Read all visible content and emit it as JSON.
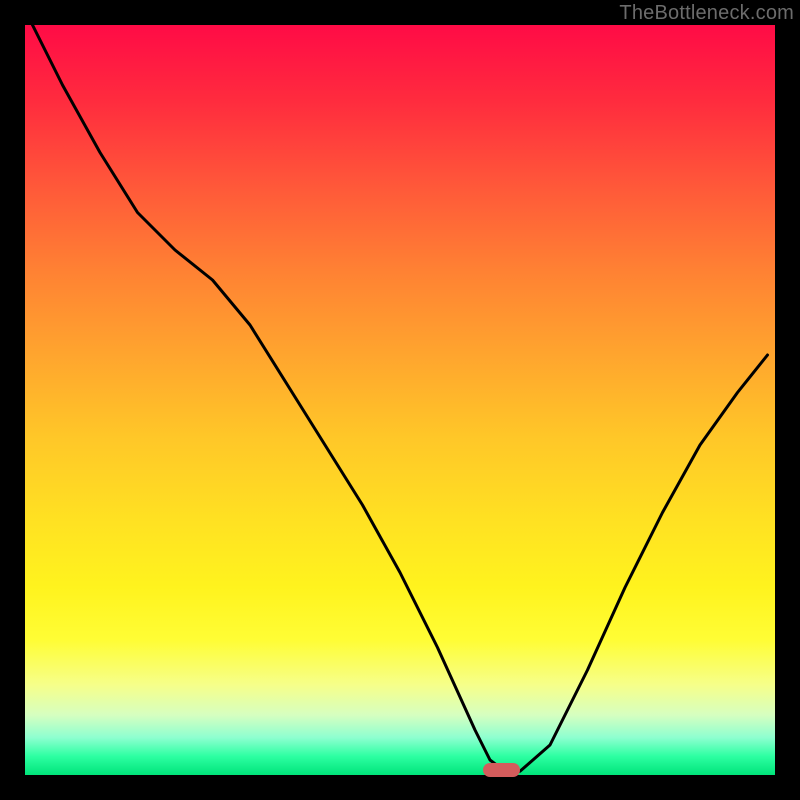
{
  "watermark": "TheBottleneck.com",
  "colors": {
    "frame": "#000000",
    "curve": "#000000",
    "marker": "#d35c5c"
  },
  "chart_data": {
    "type": "line",
    "title": "",
    "xlabel": "",
    "ylabel": "",
    "xlim": [
      0,
      100
    ],
    "ylim": [
      0,
      100
    ],
    "grid": false,
    "series": [
      {
        "name": "bottleneck-curve",
        "x": [
          1,
          5,
          10,
          15,
          20,
          25,
          30,
          35,
          40,
          45,
          50,
          55,
          60,
          62,
          64,
          66,
          70,
          75,
          80,
          85,
          90,
          95,
          99
        ],
        "y": [
          100,
          92,
          83,
          75,
          70,
          66,
          60,
          52,
          44,
          36,
          27,
          17,
          6,
          2,
          0.5,
          0.5,
          4,
          14,
          25,
          35,
          44,
          51,
          56
        ]
      }
    ],
    "annotations": [
      {
        "name": "optimal-marker",
        "x_start": 61,
        "x_end": 66,
        "y": 0.7
      }
    ]
  }
}
